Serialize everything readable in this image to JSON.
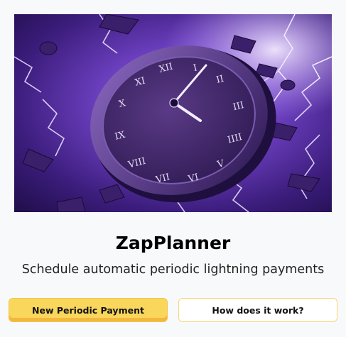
{
  "app": {
    "title": "ZapPlanner",
    "subtitle": "Schedule automatic periodic lightning payments"
  },
  "hero": {
    "image_alt": "Floating clock surrounded by lightning in a purple storm",
    "clock_numerals": [
      "XII",
      "I",
      "II",
      "III",
      "IIII",
      "V",
      "VI",
      "VII",
      "VIII",
      "IX",
      "X",
      "XI"
    ]
  },
  "actions": {
    "primary_label": "New Periodic Payment",
    "secondary_label": "How does it work?"
  },
  "colors": {
    "accent": "#f9d65c",
    "accent_border": "#f6d676",
    "hero_background": "#2a1458"
  }
}
